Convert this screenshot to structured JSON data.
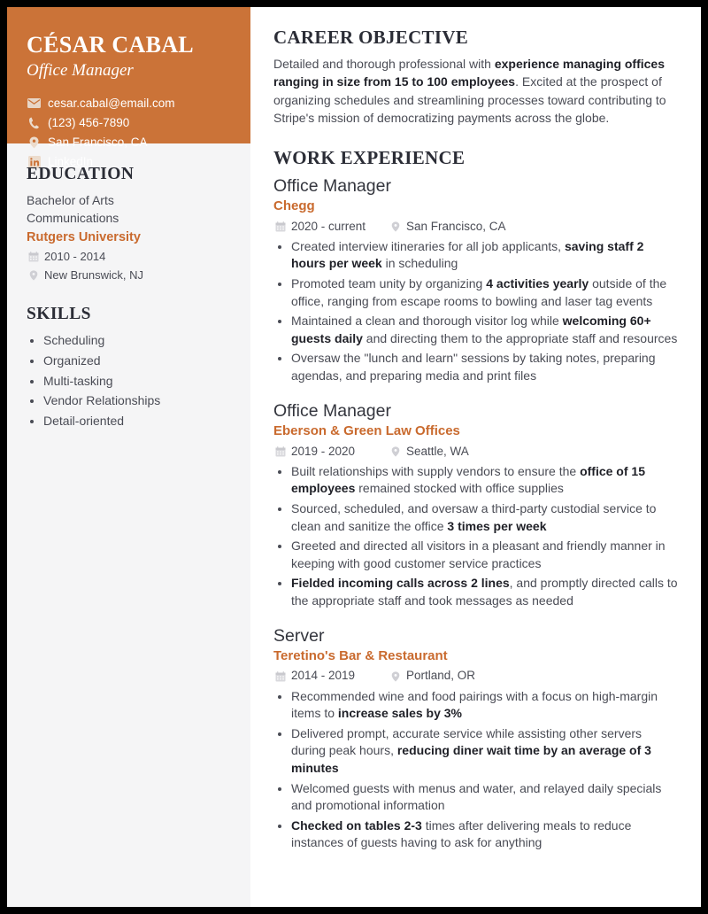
{
  "theme": {
    "accent": "#cb7338",
    "accent_text": "#c96a2e",
    "heading": "#2b2d36",
    "body": "#4a4c55",
    "sidebar_bg": "#f5f5f6",
    "page_border": "#000000"
  },
  "sidebar": {
    "name": "CÉSAR CABAL",
    "role": "Office Manager",
    "contacts": [
      {
        "icon": "email-icon",
        "text": "cesar.cabal@email.com",
        "link": false
      },
      {
        "icon": "phone-icon",
        "text": "(123) 456-7890",
        "link": false
      },
      {
        "icon": "location-pin-icon",
        "text": "San Francisco, CA",
        "link": false
      },
      {
        "icon": "linkedin-icon",
        "text": "LinkedIn",
        "link": true
      }
    ],
    "education": {
      "heading": "EDUCATION",
      "degree": "Bachelor of Arts",
      "field": "Communications",
      "school": "Rutgers University",
      "dates": "2010 - 2014",
      "location": "New Brunswick, NJ"
    },
    "skills": {
      "heading": "SKILLS",
      "items": [
        "Scheduling",
        "Organized",
        "Multi-tasking",
        "Vendor Relationships",
        "Detail-oriented"
      ]
    }
  },
  "main": {
    "objective": {
      "heading": "CAREER OBJECTIVE",
      "text_html": "Detailed and thorough professional with <b>experience managing offices ranging in size from 15 to 100 employees</b>. Excited at the prospect of organizing schedules and streamlining processes toward contributing to Stripe's mission of democratizing payments across the globe."
    },
    "work": {
      "heading": "WORK EXPERIENCE",
      "jobs": [
        {
          "title": "Office Manager",
          "company": "Chegg",
          "dates": "2020 - current",
          "location": "San Francisco, CA",
          "bullets_html": [
            "Created interview itineraries for all job applicants, <b>saving staff 2 hours per week</b> in scheduling",
            "Promoted team unity by organizing <b>4 activities yearly</b> outside of the office, ranging from escape rooms to bowling and laser tag events",
            "Maintained a clean and thorough visitor log while <b>welcoming 60+ guests daily</b> and directing them to the appropriate staff and resources",
            "Oversaw the \"lunch and learn\" sessions by taking notes, preparing agendas, and preparing media and print files"
          ]
        },
        {
          "title": "Office Manager",
          "company": "Eberson & Green Law Offices",
          "dates": "2019 - 2020",
          "location": "Seattle, WA",
          "bullets_html": [
            "Built relationships with supply vendors to ensure the <b>office of 15 employees</b> remained stocked with office supplies",
            "Sourced, scheduled, and oversaw a third-party custodial service to clean and sanitize the office <b>3 times per week</b>",
            "Greeted and directed all visitors in a pleasant and friendly manner in keeping with good customer service practices",
            "<b>Fielded incoming calls across 2 lines</b>, and promptly directed calls to the appropriate staff and took messages as needed"
          ]
        },
        {
          "title": "Server",
          "company": "Teretino's Bar & Restaurant",
          "dates": "2014 - 2019",
          "location": "Portland, OR",
          "bullets_html": [
            "Recommended wine and food pairings with a focus on high-margin items to <b>increase sales by 3%</b>",
            "Delivered prompt, accurate service while assisting other servers during peak hours, <b>reducing diner wait time by an average of 3 minutes</b>",
            "Welcomed guests with menus and water, and relayed daily specials and promotional information",
            "<b>Checked on tables 2-3</b> times after delivering meals to reduce instances of guests having to ask for anything"
          ]
        }
      ]
    }
  }
}
